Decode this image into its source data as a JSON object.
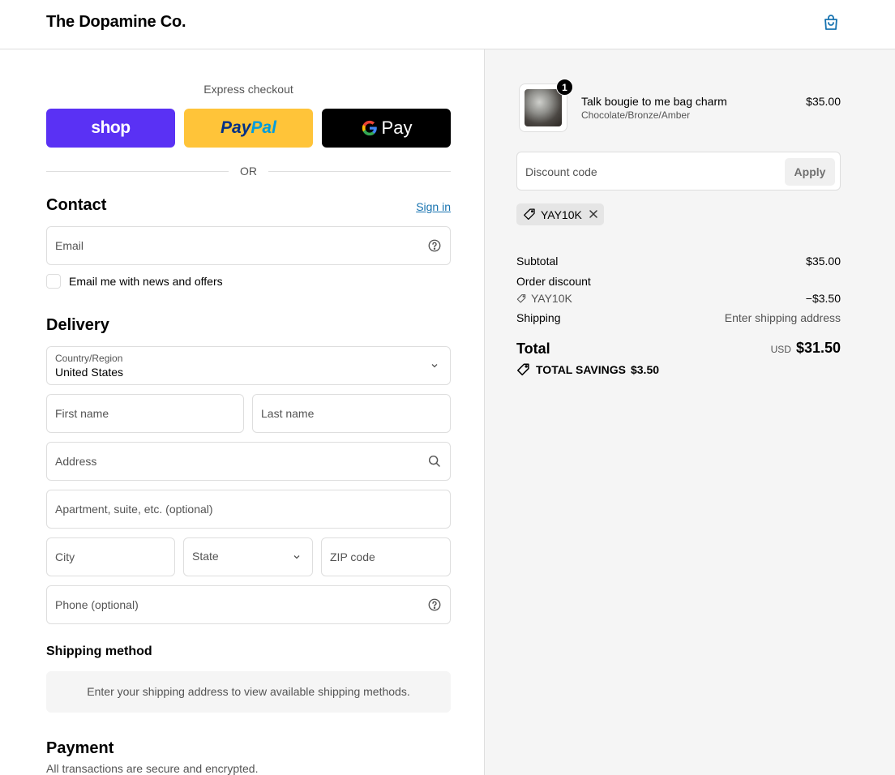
{
  "header": {
    "brand": "The Dopamine Co.",
    "cart_icon": "shopping-bag-icon"
  },
  "express": {
    "title": "Express checkout",
    "shop_label": "shop",
    "paypal_label_1": "Pay",
    "paypal_label_2": "Pal",
    "gpay_g": "G",
    "gpay_label": "Pay",
    "or_label": "OR"
  },
  "contact": {
    "title": "Contact",
    "sign_in": "Sign in",
    "email_placeholder": "Email",
    "newsletter_label": "Email me with news and offers",
    "newsletter_checked": false
  },
  "delivery": {
    "title": "Delivery",
    "country_label": "Country/Region",
    "country_value": "United States",
    "first_name": "First name",
    "last_name": "Last name",
    "address": "Address",
    "apartment": "Apartment, suite, etc. (optional)",
    "city": "City",
    "state": "State",
    "zip": "ZIP code",
    "phone": "Phone (optional)"
  },
  "shipping_method": {
    "title": "Shipping method",
    "message": "Enter your shipping address to view available shipping methods."
  },
  "payment": {
    "title": "Payment",
    "subtitle": "All transactions are secure and encrypted."
  },
  "summary": {
    "item": {
      "quantity": "1",
      "name": "Talk bougie to me bag charm",
      "variant": "Chocolate/Bronze/Amber",
      "price": "$35.00"
    },
    "discount_placeholder": "Discount code",
    "apply_label": "Apply",
    "applied_code": "YAY10K",
    "subtotal_label": "Subtotal",
    "subtotal_value": "$35.00",
    "order_discount_label": "Order discount",
    "order_discount_code": "YAY10K",
    "order_discount_value": "−$3.50",
    "shipping_label": "Shipping",
    "shipping_value": "Enter shipping address",
    "total_label": "Total",
    "currency": "USD",
    "total_value": "$31.50",
    "savings_label": "TOTAL SAVINGS",
    "savings_value": "$3.50"
  },
  "colors": {
    "shop_purple": "#5a31f4",
    "paypal_yellow": "#ffc439",
    "link_blue": "#1773b0",
    "panel_gray": "#f5f5f5"
  }
}
